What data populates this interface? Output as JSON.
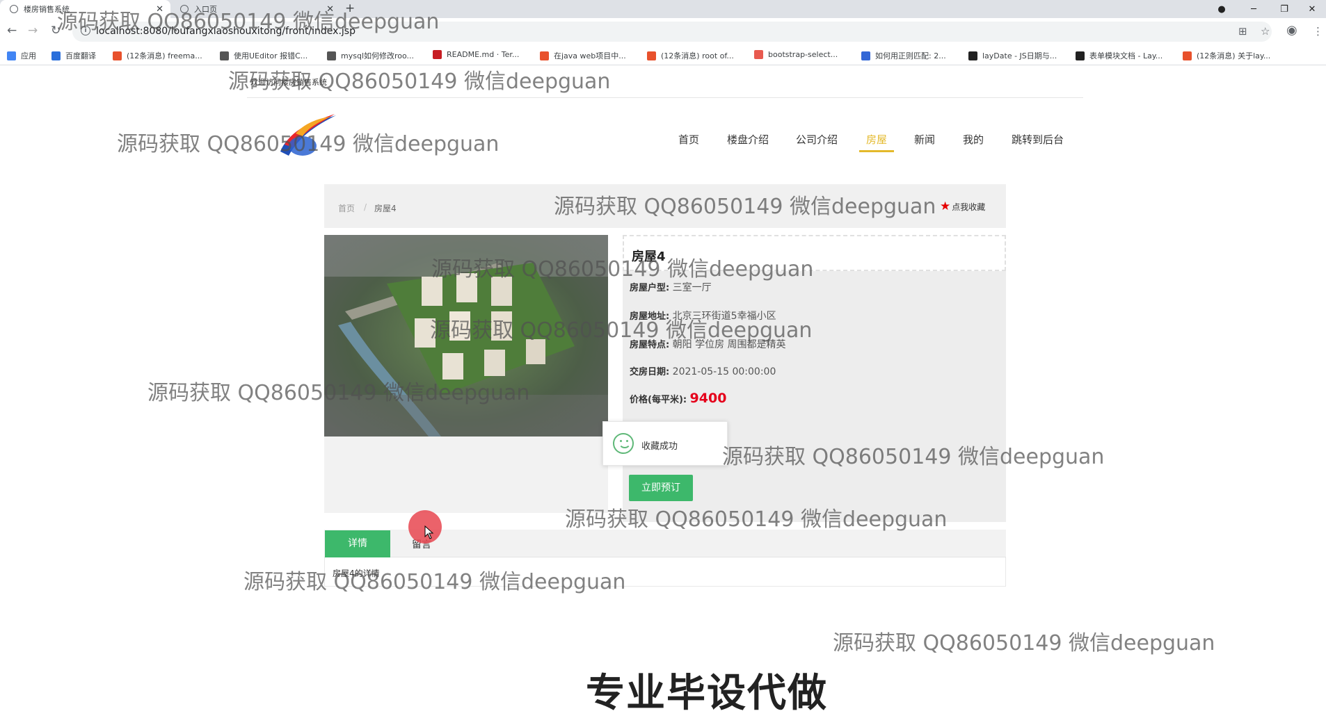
{
  "browser": {
    "tabs": [
      {
        "title": "楼房销售系统",
        "active": true
      },
      {
        "title": "入口页",
        "active": false
      }
    ],
    "url": "localhost:8080/loufangxiaoshouxitong/front/index.jsp",
    "bookmarks": [
      {
        "label": "应用",
        "color": "#4285f4"
      },
      {
        "label": "百度翻译",
        "color": "#2a6fdb"
      },
      {
        "label": "(12条消息) freema...",
        "color": "#e8512c"
      },
      {
        "label": "使用UEditor 报错C...",
        "color": "#555555"
      },
      {
        "label": "mysql如何修改roo...",
        "color": "#555555"
      },
      {
        "label": "README.md · Ter...",
        "color": "#c71d23"
      },
      {
        "label": "在java web项目中...",
        "color": "#e8512c"
      },
      {
        "label": "(12条消息) root of...",
        "color": "#e8512c"
      },
      {
        "label": "bootstrap-select...",
        "color": "#e85a4f"
      },
      {
        "label": "如何用正则匹配: 2...",
        "color": "#3367d6"
      },
      {
        "label": "layDate - JS日期与...",
        "color": "#222222"
      },
      {
        "label": "表单模块文档 - Lay...",
        "color": "#222222"
      },
      {
        "label": "(12条消息) 关于lay...",
        "color": "#e8512c"
      }
    ]
  },
  "header": {
    "welcome": "欢迎访问楼房销售系统",
    "nav": [
      {
        "label": "首页",
        "active": false
      },
      {
        "label": "楼盘介绍",
        "active": false
      },
      {
        "label": "公司介绍",
        "active": false
      },
      {
        "label": "房屋",
        "active": true
      },
      {
        "label": "新闻",
        "active": false
      },
      {
        "label": "我的",
        "active": false
      },
      {
        "label": "跳转到后台",
        "active": false
      }
    ],
    "active_color": "#e4b92b"
  },
  "breadcrumb": {
    "home": "首页",
    "separator": "/",
    "current": "房屋4",
    "favorite_label": "点我收藏"
  },
  "house": {
    "title": "房屋4",
    "fields": [
      {
        "label": "房屋户型:",
        "value": "三室一厅"
      },
      {
        "label": "房屋地址:",
        "value": "北京三环街道5幸福小区"
      },
      {
        "label": "房屋特点:",
        "value": "朝阳 学位房 周围都是精英"
      },
      {
        "label": "交房日期:",
        "value": "2021-05-15 00:00:00"
      }
    ],
    "price_label": "价格(每平米):",
    "price": "9400",
    "book_button": "立即预订"
  },
  "toast": {
    "message": "收藏成功"
  },
  "detail_tabs": {
    "tabs": [
      "详情",
      "留言"
    ],
    "active": "详情",
    "content": "房屋4的详情"
  },
  "overlay": {
    "watermark": "源码获取 QQ86050149 微信deepguan",
    "banner": "专业毕设代做"
  },
  "colors": {
    "primary_green": "#3db86b",
    "price_red": "#e5001b",
    "star_red": "#e50000"
  }
}
